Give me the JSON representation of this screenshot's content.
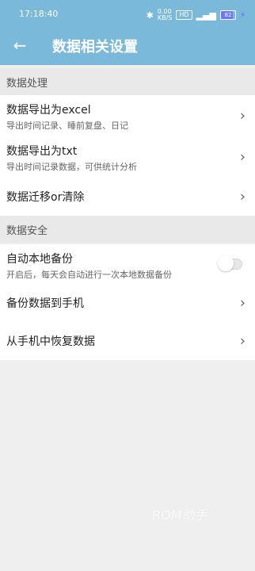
{
  "status_bar": {
    "time": "17:18:40",
    "net_speed_top": "0.00",
    "net_speed_bottom": "KB/S",
    "hd_badge": "HD",
    "signal_text": "5G",
    "battery_percent": "82",
    "battery_level": 0.82
  },
  "app_bar": {
    "title": "数据相关设置"
  },
  "sections": {
    "data_processing": {
      "label": "数据处理",
      "items": [
        {
          "title": "数据导出为excel",
          "subtitle": "导出时间记录、睡前复盘、日记"
        },
        {
          "title": "数据导出为txt",
          "subtitle": "导出时间记录数据，可供统计分析"
        },
        {
          "title": "数据迁移or清除"
        }
      ]
    },
    "data_security": {
      "label": "数据安全",
      "items": [
        {
          "title": "自动本地备份",
          "subtitle": "开启后，每天会自动进行一次本地数据备份",
          "toggle_on": false
        },
        {
          "title": "备份数据到手机"
        },
        {
          "title": "从手机中恢复数据"
        }
      ]
    }
  },
  "watermark": {
    "text": "ROM助手"
  },
  "icons": {
    "back": "arrow-left",
    "chevron": "chevron-right",
    "bluetooth": "bluetooth",
    "signal": "signal-bars",
    "battery": "battery",
    "charging": "lightning-bolt"
  }
}
